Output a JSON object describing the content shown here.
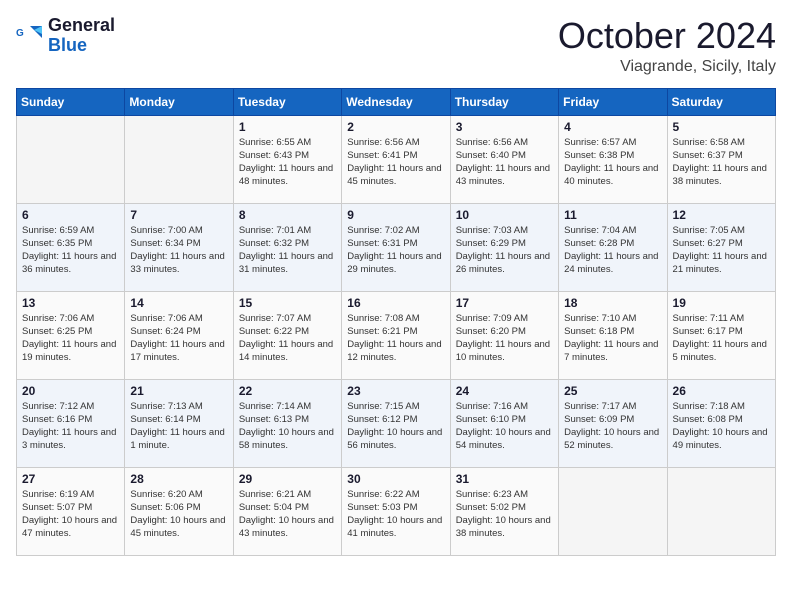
{
  "header": {
    "logo_line1": "General",
    "logo_line2": "Blue",
    "month": "October 2024",
    "location": "Viagrande, Sicily, Italy"
  },
  "days_of_week": [
    "Sunday",
    "Monday",
    "Tuesday",
    "Wednesday",
    "Thursday",
    "Friday",
    "Saturday"
  ],
  "weeks": [
    [
      {
        "day": "",
        "info": ""
      },
      {
        "day": "",
        "info": ""
      },
      {
        "day": "1",
        "info": "Sunrise: 6:55 AM\nSunset: 6:43 PM\nDaylight: 11 hours and 48 minutes."
      },
      {
        "day": "2",
        "info": "Sunrise: 6:56 AM\nSunset: 6:41 PM\nDaylight: 11 hours and 45 minutes."
      },
      {
        "day": "3",
        "info": "Sunrise: 6:56 AM\nSunset: 6:40 PM\nDaylight: 11 hours and 43 minutes."
      },
      {
        "day": "4",
        "info": "Sunrise: 6:57 AM\nSunset: 6:38 PM\nDaylight: 11 hours and 40 minutes."
      },
      {
        "day": "5",
        "info": "Sunrise: 6:58 AM\nSunset: 6:37 PM\nDaylight: 11 hours and 38 minutes."
      }
    ],
    [
      {
        "day": "6",
        "info": "Sunrise: 6:59 AM\nSunset: 6:35 PM\nDaylight: 11 hours and 36 minutes."
      },
      {
        "day": "7",
        "info": "Sunrise: 7:00 AM\nSunset: 6:34 PM\nDaylight: 11 hours and 33 minutes."
      },
      {
        "day": "8",
        "info": "Sunrise: 7:01 AM\nSunset: 6:32 PM\nDaylight: 11 hours and 31 minutes."
      },
      {
        "day": "9",
        "info": "Sunrise: 7:02 AM\nSunset: 6:31 PM\nDaylight: 11 hours and 29 minutes."
      },
      {
        "day": "10",
        "info": "Sunrise: 7:03 AM\nSunset: 6:29 PM\nDaylight: 11 hours and 26 minutes."
      },
      {
        "day": "11",
        "info": "Sunrise: 7:04 AM\nSunset: 6:28 PM\nDaylight: 11 hours and 24 minutes."
      },
      {
        "day": "12",
        "info": "Sunrise: 7:05 AM\nSunset: 6:27 PM\nDaylight: 11 hours and 21 minutes."
      }
    ],
    [
      {
        "day": "13",
        "info": "Sunrise: 7:06 AM\nSunset: 6:25 PM\nDaylight: 11 hours and 19 minutes."
      },
      {
        "day": "14",
        "info": "Sunrise: 7:06 AM\nSunset: 6:24 PM\nDaylight: 11 hours and 17 minutes."
      },
      {
        "day": "15",
        "info": "Sunrise: 7:07 AM\nSunset: 6:22 PM\nDaylight: 11 hours and 14 minutes."
      },
      {
        "day": "16",
        "info": "Sunrise: 7:08 AM\nSunset: 6:21 PM\nDaylight: 11 hours and 12 minutes."
      },
      {
        "day": "17",
        "info": "Sunrise: 7:09 AM\nSunset: 6:20 PM\nDaylight: 11 hours and 10 minutes."
      },
      {
        "day": "18",
        "info": "Sunrise: 7:10 AM\nSunset: 6:18 PM\nDaylight: 11 hours and 7 minutes."
      },
      {
        "day": "19",
        "info": "Sunrise: 7:11 AM\nSunset: 6:17 PM\nDaylight: 11 hours and 5 minutes."
      }
    ],
    [
      {
        "day": "20",
        "info": "Sunrise: 7:12 AM\nSunset: 6:16 PM\nDaylight: 11 hours and 3 minutes."
      },
      {
        "day": "21",
        "info": "Sunrise: 7:13 AM\nSunset: 6:14 PM\nDaylight: 11 hours and 1 minute."
      },
      {
        "day": "22",
        "info": "Sunrise: 7:14 AM\nSunset: 6:13 PM\nDaylight: 10 hours and 58 minutes."
      },
      {
        "day": "23",
        "info": "Sunrise: 7:15 AM\nSunset: 6:12 PM\nDaylight: 10 hours and 56 minutes."
      },
      {
        "day": "24",
        "info": "Sunrise: 7:16 AM\nSunset: 6:10 PM\nDaylight: 10 hours and 54 minutes."
      },
      {
        "day": "25",
        "info": "Sunrise: 7:17 AM\nSunset: 6:09 PM\nDaylight: 10 hours and 52 minutes."
      },
      {
        "day": "26",
        "info": "Sunrise: 7:18 AM\nSunset: 6:08 PM\nDaylight: 10 hours and 49 minutes."
      }
    ],
    [
      {
        "day": "27",
        "info": "Sunrise: 6:19 AM\nSunset: 5:07 PM\nDaylight: 10 hours and 47 minutes."
      },
      {
        "day": "28",
        "info": "Sunrise: 6:20 AM\nSunset: 5:06 PM\nDaylight: 10 hours and 45 minutes."
      },
      {
        "day": "29",
        "info": "Sunrise: 6:21 AM\nSunset: 5:04 PM\nDaylight: 10 hours and 43 minutes."
      },
      {
        "day": "30",
        "info": "Sunrise: 6:22 AM\nSunset: 5:03 PM\nDaylight: 10 hours and 41 minutes."
      },
      {
        "day": "31",
        "info": "Sunrise: 6:23 AM\nSunset: 5:02 PM\nDaylight: 10 hours and 38 minutes."
      },
      {
        "day": "",
        "info": ""
      },
      {
        "day": "",
        "info": ""
      }
    ]
  ]
}
